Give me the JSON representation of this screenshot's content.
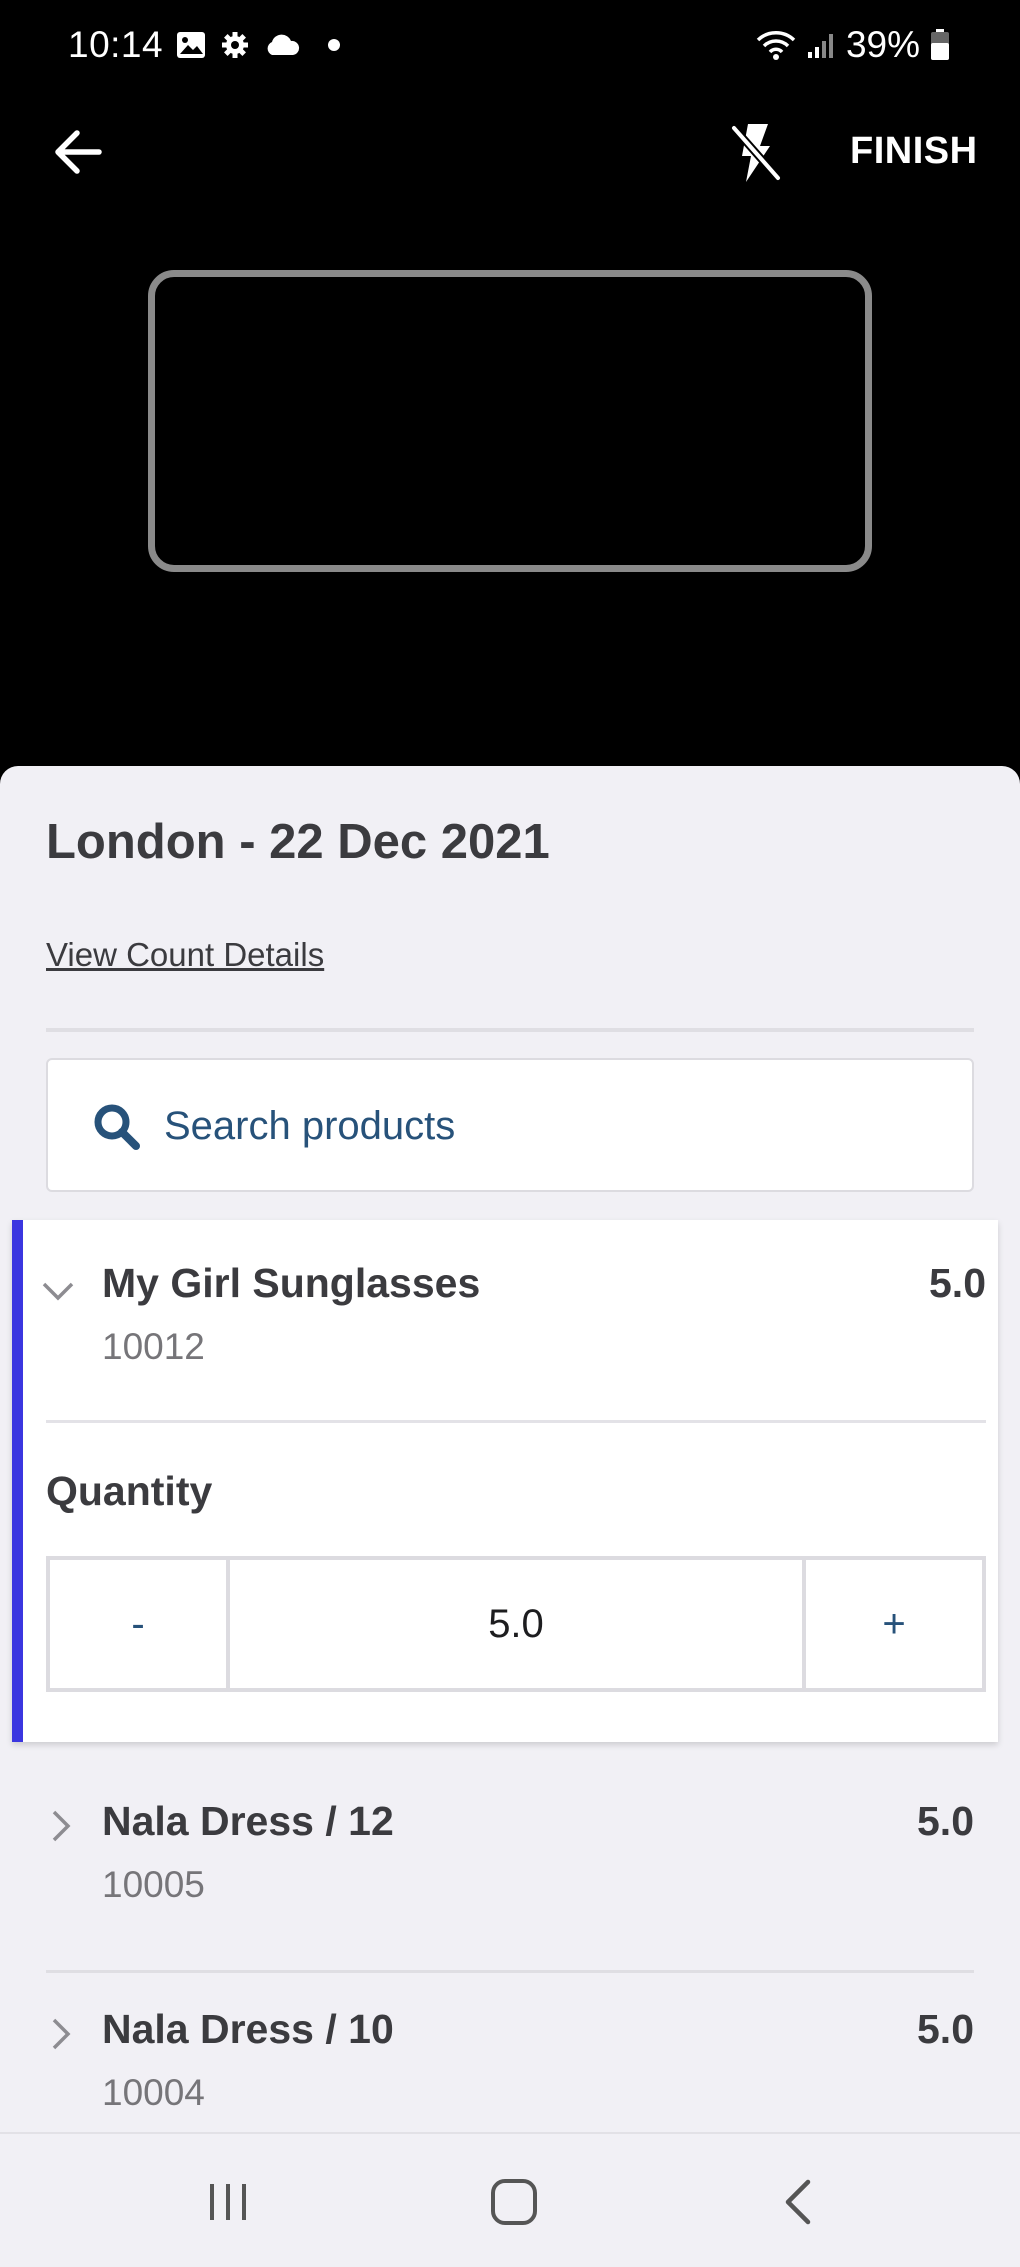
{
  "status_bar": {
    "time": "10:14",
    "battery": "39%",
    "icons": [
      "gallery-icon",
      "settings-icon",
      "cloud-icon",
      "dot-icon",
      "wifi-icon",
      "signal-icon",
      "battery-icon"
    ]
  },
  "header": {
    "back_icon": "arrow-left-icon",
    "flash_icon": "flash-off-icon",
    "finish_label": "FINISH"
  },
  "sheet": {
    "title": "London - 22 Dec 2021",
    "view_details_label": "View Count Details",
    "search": {
      "placeholder": "Search products",
      "icon": "search-icon"
    }
  },
  "products": [
    {
      "name": "My Girl Sunglasses",
      "sku": "10012",
      "qty": "5.0",
      "expanded": true,
      "quantity_label": "Quantity",
      "minus_label": "-",
      "plus_label": "+",
      "stepper_value": "5.0"
    },
    {
      "name": "Nala Dress / 12",
      "sku": "10005",
      "qty": "5.0",
      "expanded": false
    },
    {
      "name": "Nala Dress / 10",
      "sku": "10004",
      "qty": "5.0",
      "expanded": false
    }
  ],
  "colors": {
    "accent": "#3b36e0",
    "link_blue": "#27527a",
    "sheet_bg": "#f1f0f5"
  },
  "nav_bar": {
    "icons": [
      "recent-apps-icon",
      "home-icon",
      "back-icon"
    ]
  }
}
